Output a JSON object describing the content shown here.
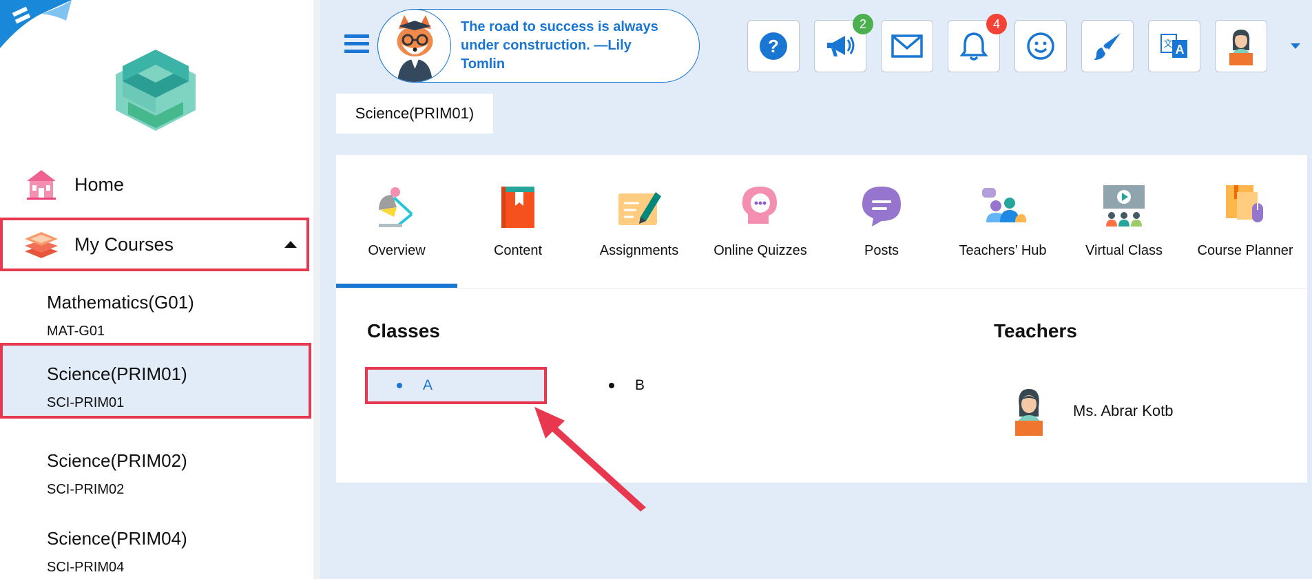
{
  "header": {
    "quote": "The road to success is always under construction. —Lily Tomlin",
    "buttons": [
      {
        "name": "help-icon",
        "badge": ""
      },
      {
        "name": "megaphone-icon",
        "badge": "2",
        "badge_color": "#4caf50"
      },
      {
        "name": "mail-icon",
        "badge": ""
      },
      {
        "name": "bell-icon",
        "badge": "4",
        "badge_color": "#f44336"
      },
      {
        "name": "smiley-icon",
        "badge": ""
      },
      {
        "name": "brush-icon",
        "badge": ""
      },
      {
        "name": "translate-icon",
        "badge": ""
      },
      {
        "name": "user-avatar-icon",
        "badge": ""
      }
    ]
  },
  "sidebar": {
    "nav": [
      {
        "label": "Home",
        "icon": "home-icon"
      },
      {
        "label": "My Courses",
        "icon": "stack-icon"
      }
    ],
    "courses": [
      {
        "name": "Mathematics(G01)",
        "code": "MAT-G01"
      },
      {
        "name": "Science(PRIM01)",
        "code": "SCI-PRIM01"
      },
      {
        "name": "Science(PRIM02)",
        "code": "SCI-PRIM02"
      },
      {
        "name": "Science(PRIM04)",
        "code": "SCI-PRIM04"
      }
    ]
  },
  "breadcrumb": {
    "course": "Science(PRIM01)"
  },
  "tabs": [
    {
      "label": "Overview",
      "icon": "lamp-icon"
    },
    {
      "label": "Content",
      "icon": "book-icon"
    },
    {
      "label": "Assignments",
      "icon": "pen-paper-icon"
    },
    {
      "label": "Online Quizzes",
      "icon": "head-thought-icon"
    },
    {
      "label": "Posts",
      "icon": "chat-bubble-icon"
    },
    {
      "label": "Teachers’ Hub",
      "icon": "people-chat-icon"
    },
    {
      "label": "Virtual Class",
      "icon": "screen-audience-icon"
    },
    {
      "label": "Course Planner",
      "icon": "planner-icon"
    }
  ],
  "overview": {
    "classes_title": "Classes",
    "classes": [
      "A",
      "B"
    ],
    "teachers_title": "Teachers",
    "teachers": [
      {
        "name": "Ms. Abrar Kotb"
      }
    ]
  },
  "colors": {
    "accent": "#1976d2",
    "highlight": "#e8384f",
    "background": "#e1ecf8"
  }
}
